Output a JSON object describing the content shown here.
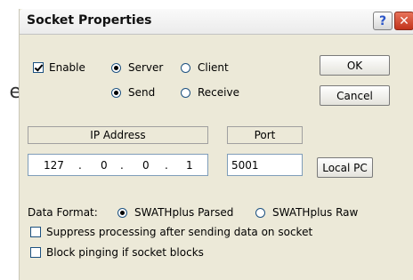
{
  "background_fragment": "e",
  "dialog": {
    "title": "Socket Properties",
    "help_glyph": "?",
    "close_glyph": "✕"
  },
  "controls": {
    "enable_label": "Enable",
    "enable_checked": true,
    "mode": {
      "server_label": "Server",
      "client_label": "Client",
      "selected": "Server"
    },
    "direction": {
      "send_label": "Send",
      "receive_label": "Receive",
      "selected": "Send"
    }
  },
  "buttons": {
    "ok": "OK",
    "cancel": "Cancel",
    "local_pc": "Local PC"
  },
  "network": {
    "ip_header": "IP Address",
    "port_header": "Port",
    "ip_octets": [
      "127",
      "0",
      "0",
      "1"
    ],
    "ip_separator": ".",
    "port_value": "5001"
  },
  "data_format": {
    "label": "Data Format:",
    "parsed_label": "SWATHplus Parsed",
    "raw_label": "SWATHplus Raw",
    "selected": "SWATHplus Parsed"
  },
  "options": {
    "suppress_label": "Suppress processing after sending data on socket",
    "suppress_checked": false,
    "block_label": "Block pinging if socket blocks",
    "block_checked": false
  }
}
